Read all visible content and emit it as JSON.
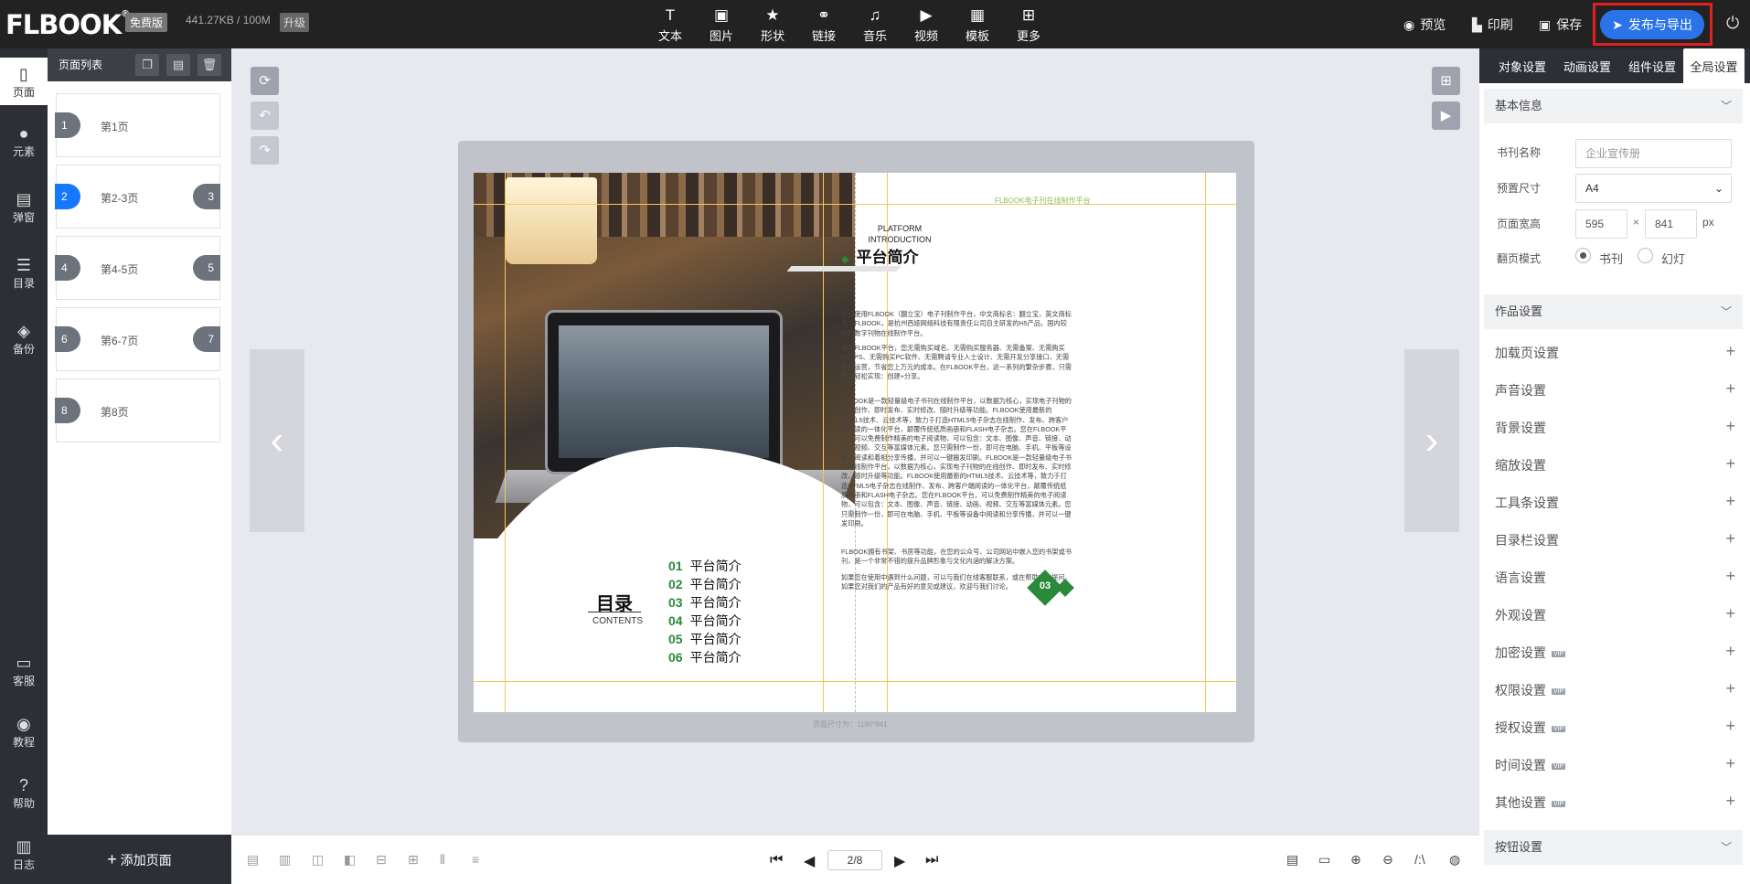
{
  "topbar": {
    "logo": "FLBOOK",
    "logo_mark": "®",
    "free_badge": "免费版",
    "storage": "441.27KB / 100M",
    "upgrade": "升级",
    "tools": [
      {
        "label": "文本",
        "icon": "text-icon",
        "glyph": "T"
      },
      {
        "label": "图片",
        "icon": "image-icon",
        "glyph": "▣"
      },
      {
        "label": "形状",
        "icon": "shape-icon",
        "glyph": "★"
      },
      {
        "label": "链接",
        "icon": "link-icon",
        "glyph": "⚭"
      },
      {
        "label": "音乐",
        "icon": "music-icon",
        "glyph": "♫"
      },
      {
        "label": "视频",
        "icon": "video-icon",
        "glyph": "▶"
      },
      {
        "label": "模板",
        "icon": "template-icon",
        "glyph": "▦"
      },
      {
        "label": "更多",
        "icon": "more-icon",
        "glyph": "⊞"
      }
    ],
    "preview": "预览",
    "print": "印刷",
    "save": "保存",
    "publish": "发布与导出"
  },
  "leftnav": [
    {
      "label": "页面",
      "icon": "page-icon",
      "glyph": "▯"
    },
    {
      "label": "元素",
      "icon": "element-icon",
      "glyph": "●"
    },
    {
      "label": "弹窗",
      "icon": "popup-icon",
      "glyph": "▤"
    },
    {
      "label": "目录",
      "icon": "catalog-icon",
      "glyph": "☰"
    },
    {
      "label": "备份",
      "icon": "backup-icon",
      "glyph": "◈"
    },
    {
      "label": "客服",
      "icon": "service-icon",
      "glyph": "▭"
    },
    {
      "label": "教程",
      "icon": "tutorial-icon",
      "glyph": "◉"
    },
    {
      "label": "帮助",
      "icon": "help-icon",
      "glyph": "?"
    },
    {
      "label": "日志",
      "icon": "log-icon",
      "glyph": "▥"
    }
  ],
  "pages": {
    "title": "页面列表",
    "items": [
      {
        "label": "第1页",
        "num": "1",
        "num2": ""
      },
      {
        "label": "第2-3页",
        "num": "2",
        "num2": "3"
      },
      {
        "label": "第4-5页",
        "num": "4",
        "num2": "5"
      },
      {
        "label": "第6-7页",
        "num": "6",
        "num2": "7"
      },
      {
        "label": "第8页",
        "num": "8",
        "num2": ""
      }
    ],
    "add": "添加页面"
  },
  "book": {
    "size_note": "页面尺寸为：1190*841",
    "toc_title": "目录",
    "toc_sub": "CONTENTS",
    "toc": [
      {
        "n": "01",
        "t": "平台简介"
      },
      {
        "n": "02",
        "t": "平台简介"
      },
      {
        "n": "03",
        "t": "平台简介"
      },
      {
        "n": "04",
        "t": "平台简介"
      },
      {
        "n": "05",
        "t": "平台简介"
      },
      {
        "n": "06",
        "t": "平台简介"
      }
    ],
    "right_header": "FLBOOK电子刊在线制作平台",
    "platform_en1": "PLATFORM",
    "platform_en2": "INTRODUCTION",
    "platform_title": "平台简介",
    "paragraphs": [
      "欢迎使用FLBOOK（翻立宝）电子刊制作平台，中文商标名：翻立宝，英文商标名：FLBOOK，是杭州西娅网络科技有限责任公司自主研发的H5产品，国内较先的数字刊物在线制作平台。",
      "使用FLBOOK平台，您无需购买域名、无需购买服务器、无需备案、无需购买HTTPS、无需购买PC软件、无需聘请专业人士设计、无需开发分享接口、无需完善运营，节省您上万元的成本。在FLBOOK平台，这一系列的繁杂步骤，只需两步轻松实现：创建+分享。",
      "FLBOOK是一款轻量级电子书刊在线制作平台，以数据为核心，实现电子刊物的在线创作、即时发布、实时修改、随时升级等功能。FLBOOK使用最新的HTML5技术、云技术等，致力于打造HTML5电子杂志在线制作、发布、跨客户端阅读的一体化平台，颠覆传统纸质画册和FLASH电子杂志。您在FLBOOK平台，可以免费制作精美的电子阅读物，可以包含：文本、图像、声音、链接、动画、视频、交互等富媒体元素。您只需制作一份，即可在电脑、手机、平板等设备中阅读和着相分享传播，并可以一键搬发印刷。FLBOOK是一款轻量级电子书刊在线制作平台，以数据为核心，实现电子刊物的在线创作、即时发布、实时修改、随时升级等功能。FLBOOK使用最新的HTML5技术、云技术等，致力于打造HTML5电子杂志在线制作、发布、跨客户端阅读的一体化平台，颠覆传统纸质画册和FLASH电子杂志。您在FLBOOK平台，可以免费制作精美的电子阅读物，可以包含：文本、图像、声音、链接、动画、视频、交互等富媒体元素。您只需制作一份，即可在电脑、手机、平板等设备中阅读和分享传播，并可以一键发印刷。",
      "FLBOOK拥有书架、书房等功能，在您的公众号、公司网站中嵌入您的书架或书刊，是一个非常不错的提升品牌形象与文化内涵的解决方案。",
      "如果您在使用中遇到什么问题，可以与我们在线客服联系，或在帮助中心提问。如果您对我们的产品有好的意见或建议，欢迎与我们讨论。"
    ],
    "page_number": "03"
  },
  "bottombar": {
    "page_indicator": "2/8"
  },
  "rightpanel": {
    "tabs": [
      "对象设置",
      "动画设置",
      "组件设置",
      "全局设置"
    ],
    "basic_info": "基本信息",
    "name_label": "书刊名称",
    "name_placeholder": "企业宣传册",
    "size_label": "预置尺寸",
    "size_value": "A4",
    "wh_label": "页面宽高",
    "width": "595",
    "times": "×",
    "height": "841",
    "unit": "px",
    "flip_label": "翻页模式",
    "flip_book": "书刊",
    "flip_slide": "幻灯",
    "works_settings": "作品设置",
    "settings": [
      {
        "label": "加载页设置",
        "vip": ""
      },
      {
        "label": "声音设置",
        "vip": ""
      },
      {
        "label": "背景设置",
        "vip": ""
      },
      {
        "label": "缩放设置",
        "vip": ""
      },
      {
        "label": "工具条设置",
        "vip": ""
      },
      {
        "label": "目录栏设置",
        "vip": ""
      },
      {
        "label": "语言设置",
        "vip": ""
      },
      {
        "label": "外观设置",
        "vip": ""
      },
      {
        "label": "加密设置",
        "vip": "VIP"
      },
      {
        "label": "权限设置",
        "vip": "VIP"
      },
      {
        "label": "授权设置",
        "vip": "VIP"
      },
      {
        "label": "时间设置",
        "vip": "VIP"
      },
      {
        "label": "其他设置",
        "vip": "VIP"
      }
    ],
    "button_settings": "按钮设置"
  }
}
